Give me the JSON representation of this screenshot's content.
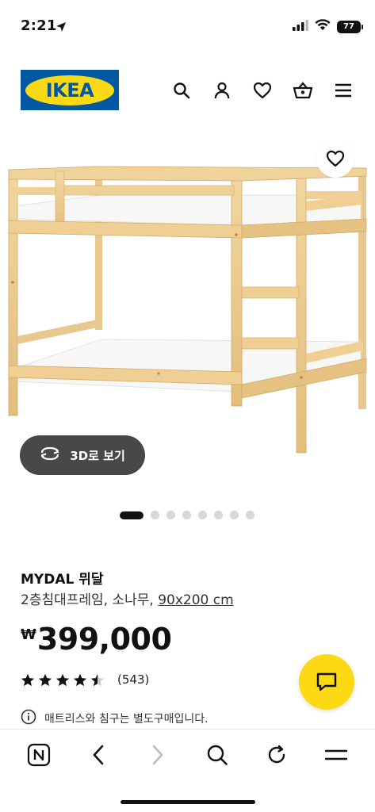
{
  "status_bar": {
    "time": "2:21",
    "battery": "77"
  },
  "header": {
    "logo_text": "IKEA",
    "icons": [
      "search-icon",
      "account-icon",
      "heart-icon",
      "cart-icon",
      "menu-icon"
    ]
  },
  "gallery": {
    "button_3d_label": "3D로 보기",
    "dot_count": 8,
    "active_index": 0
  },
  "product": {
    "name": "MYDAL 뮈달",
    "description": "2층침대프레임, 소나무, ",
    "size_link": "90x200 cm",
    "currency": "₩",
    "price": "399,000",
    "rating": 4.5,
    "review_count": "(543)",
    "notice": "매트리스와 침구는 별도구매입니다."
  },
  "browser": {
    "buttons": [
      "tabs-icon",
      "back-icon",
      "forward-icon",
      "search-icon",
      "reload-icon",
      "menu-icon"
    ]
  },
  "colors": {
    "ikea_blue": "#0058a3",
    "ikea_yellow": "#fbd914"
  }
}
